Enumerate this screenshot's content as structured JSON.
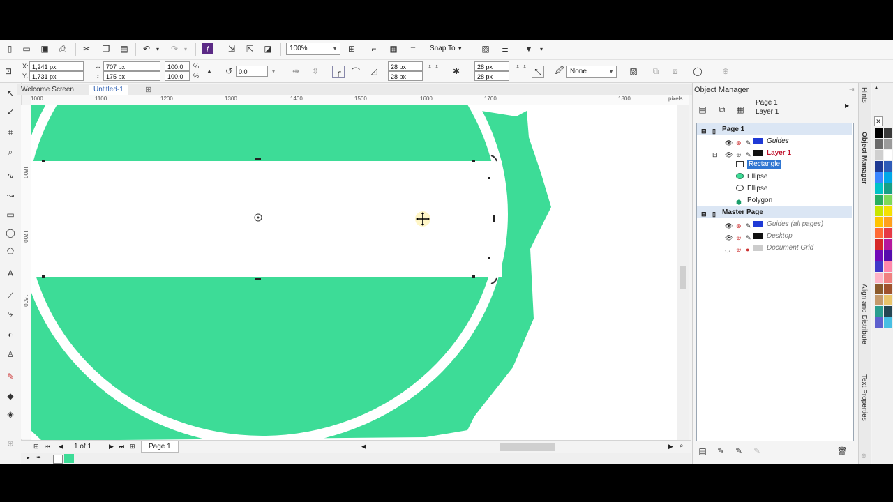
{
  "toolbar_top": {
    "zoom_value": "100%",
    "snap_to_label": "Snap To"
  },
  "property_bar": {
    "x_value": "1,241 px",
    "y_value": "1,731 px",
    "width_value": "707 px",
    "height_value": "175 px",
    "scale_w": "100.0",
    "scale_h": "100.0",
    "percent_symbol": "%",
    "rotation_value": "0.0",
    "corner_1": "28 px",
    "corner_2": "28 px",
    "corner_3": "28 px",
    "corner_4": "28 px",
    "outline_value": "None"
  },
  "tabs": [
    {
      "label": "Welcome Screen"
    },
    {
      "label": "Untitled-1"
    }
  ],
  "ruler_h_labels": [
    "1000",
    "1100",
    "1200",
    "1300",
    "1400",
    "1500",
    "1600",
    "1700",
    "1800",
    "pixels"
  ],
  "ruler_v_labels": [
    "1800",
    "1700",
    "1600"
  ],
  "canvas": {
    "shape_color": "#3ddc97"
  },
  "status": {
    "page_count": "1 of 1",
    "page_tab": "Page 1"
  },
  "object_manager": {
    "title": "Object Manager",
    "current_page": "Page 1",
    "current_layer": "Layer 1",
    "tree": {
      "page1": "Page 1",
      "guides": "Guides",
      "layer1": "Layer 1",
      "rectangle": "Rectangle",
      "ellipse1": "Ellipse",
      "ellipse2": "Ellipse",
      "polygon": "Polygon",
      "master_page": "Master Page",
      "guides_all": "Guides (all pages)",
      "desktop": "Desktop",
      "document_grid": "Document Grid"
    }
  },
  "side_tabs": {
    "hints": "Hints",
    "object_manager": "Object Manager",
    "align": "Align and Distribute",
    "text_props": "Text Properties"
  },
  "palette_colors": [
    "#000000",
    "#3a3a3a",
    "#6b6b6b",
    "#9b9b9b",
    "#cfcfcf",
    "#ffffff",
    "#1f3a93",
    "#2e5cb8",
    "#3a86ff",
    "#00a8e8",
    "#00c2c7",
    "#16a085",
    "#27ae60",
    "#7ed957",
    "#c8e600",
    "#f5e000",
    "#ffc400",
    "#ff9f1c",
    "#ff6b35",
    "#e63946",
    "#d62828",
    "#b5179e",
    "#7209b7",
    "#560bad",
    "#3f37c9",
    "#ff87ab",
    "#ffb3c6",
    "#f08080",
    "#8b5a2b",
    "#a0522d",
    "#c49a6c",
    "#e9c46a",
    "#2a9d8f",
    "#264653",
    "#5e60ce",
    "#48bfe3"
  ]
}
